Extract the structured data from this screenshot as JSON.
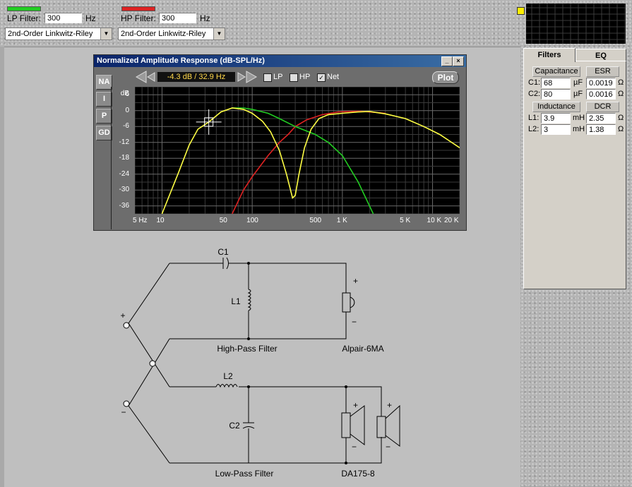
{
  "filters": {
    "lp": {
      "label": "LP Filter:",
      "value": "300",
      "unit": "Hz",
      "type": "2nd-Order Linkwitz-Riley",
      "color": "#22cc22"
    },
    "hp": {
      "label": "HP Filter:",
      "value": "300",
      "unit": "Hz",
      "type": "2nd-Order Linkwitz-Riley",
      "color": "#dd2222"
    }
  },
  "chart_window": {
    "title": "Normalized Amplitude Response (dB-SPL/Hz)",
    "minimize": "_",
    "close": "×",
    "side_buttons": [
      "NA",
      "I",
      "P",
      "GD"
    ],
    "readout": "-4.3 dB / 32.9 Hz",
    "checks": [
      {
        "label": "LP",
        "checked": false
      },
      {
        "label": "HP",
        "checked": false
      },
      {
        "label": "Net",
        "checked": true
      }
    ],
    "plot_label": "Plot",
    "y_unit": "dB",
    "y_ticks": [
      "6",
      "0",
      "-6",
      "-12",
      "-18",
      "-24",
      "-30",
      "-36"
    ],
    "x_ticks": [
      "5 Hz",
      "10",
      "50",
      "100",
      "500",
      "1 K",
      "5 K",
      "10 K",
      "20 K"
    ]
  },
  "chart_data": {
    "type": "line",
    "ylabel": "dB",
    "xscale": "log",
    "xlim": [
      5,
      20000
    ],
    "ylim": [
      -39,
      9
    ],
    "series": [
      {
        "color": "#ffff44",
        "x": [
          10,
          15,
          20,
          25,
          33,
          45,
          60,
          80,
          100,
          130,
          160,
          200,
          240,
          280,
          300,
          330,
          380,
          450,
          550,
          700,
          1000,
          1500,
          2000,
          3000,
          5000,
          8000,
          12000,
          20000
        ],
        "y": [
          -39,
          -24,
          -13,
          -7,
          -4.3,
          -0.5,
          1,
          0.5,
          -1,
          -4,
          -8,
          -15,
          -24,
          -33,
          -32,
          -24,
          -14,
          -7,
          -3,
          -1.5,
          -1,
          -0.5,
          -0.3,
          -1.2,
          -3,
          -6,
          -9,
          -14
        ]
      },
      {
        "color": "#22cc22",
        "x": [
          60,
          80,
          100,
          150,
          200,
          300,
          500,
          700,
          1000,
          1500,
          2200
        ],
        "y": [
          1,
          1,
          0.5,
          -1,
          -3,
          -6,
          -9,
          -12,
          -17,
          -27,
          -39
        ]
      },
      {
        "color": "#dd2222",
        "x": [
          60,
          80,
          100,
          150,
          200,
          250,
          300,
          400,
          600,
          900,
          1200,
          1500,
          2000,
          3000
        ],
        "y": [
          -39,
          -30,
          -25,
          -17,
          -12,
          -9,
          -6,
          -3.5,
          -1.5,
          -0.5,
          -0.3,
          -0.2,
          -0.5,
          -1
        ]
      }
    ]
  },
  "tabs": [
    {
      "label": "Filters",
      "active": true
    },
    {
      "label": "EQ",
      "active": false
    }
  ],
  "components": {
    "capacitance_hdr": "Capacitance",
    "esr_hdr": "ESR",
    "c1": {
      "label": "C1:",
      "value": "68",
      "unit": "µF",
      "esr": "0.00192",
      "esr_unit": "Ω"
    },
    "c2": {
      "label": "C2:",
      "value": "80",
      "unit": "µF",
      "esr": "0.0016",
      "esr_unit": "Ω"
    },
    "inductance_hdr": "Inductance",
    "dcr_hdr": "DCR",
    "l1": {
      "label": "L1:",
      "value": "3.9",
      "unit": "mH",
      "dcr": "2.35",
      "dcr_unit": "Ω"
    },
    "l2": {
      "label": "L2:",
      "value": "3",
      "unit": "mH",
      "dcr": "1.38",
      "dcr_unit": "Ω"
    }
  },
  "circuit": {
    "c1": "C1",
    "l1": "L1",
    "l2": "L2",
    "c2": "C2",
    "plus": "+",
    "minus": "−",
    "hp_caption": "High-Pass Filter",
    "lp_caption": "Low-Pass Filter",
    "tweeter_name": "Alpair-6MA",
    "woofer_name": "DA175-8"
  }
}
